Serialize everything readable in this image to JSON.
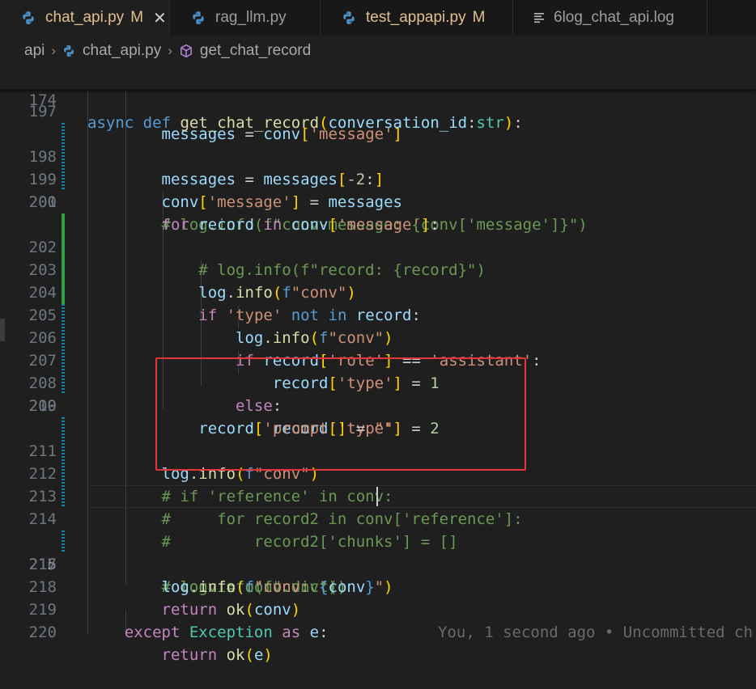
{
  "tabs": [
    {
      "label": "chat_api.py",
      "status": "M",
      "active": true,
      "icon": "python-icon"
    },
    {
      "label": "rag_llm.py",
      "status": "",
      "active": false,
      "icon": "python-icon"
    },
    {
      "label": "test_appapi.py",
      "status": "M",
      "active": false,
      "icon": "python-icon"
    },
    {
      "label": "6log_chat_api.log",
      "status": "",
      "active": false,
      "icon": "log-file-icon"
    }
  ],
  "close_glyph": "✕",
  "breadcrumb": {
    "folder": "api",
    "file": "chat_api.py",
    "symbol": "get_chat_record",
    "separator": "›"
  },
  "sticky_line": {
    "number": "174"
  },
  "line_numbers": [
    "197",
    "198",
    "199",
    "200",
    "201",
    "202",
    "203",
    "204",
    "205",
    "206",
    "207",
    "208",
    "209",
    "210",
    "211",
    "212",
    "213",
    "214",
    "215",
    "216",
    "217",
    "218",
    "219",
    "220"
  ],
  "current_line": "215",
  "blame": "You, 1 second ago • Uncommitted ch",
  "colors": {
    "background": "#1f1f1f",
    "tab_modified": "#e2c08d",
    "highlight_box": "#e5323b",
    "gutter_added": "#2ea043",
    "gutter_modified": "#1b81a8"
  }
}
